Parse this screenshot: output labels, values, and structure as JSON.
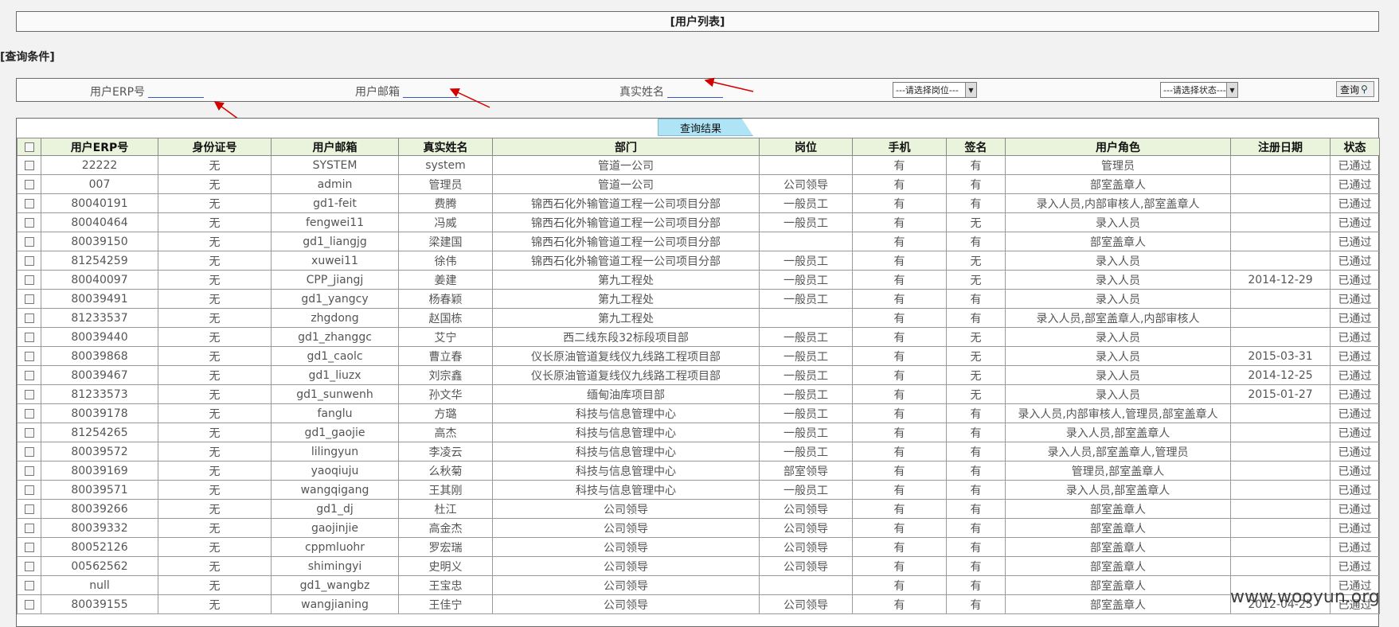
{
  "page": {
    "title": "[用户列表]",
    "query_section_label": "[查询条件]"
  },
  "query": {
    "erp_label": "用户ERP号",
    "email_label": "用户邮箱",
    "realname_label": "真实姓名",
    "position_select": "---请选择岗位---",
    "status_select": "---请选择状态---",
    "search_button": "查询"
  },
  "results": {
    "tab_label": "查询结果",
    "columns": [
      "",
      "用户ERP号",
      "身份证号",
      "用户邮箱",
      "真实姓名",
      "部门",
      "岗位",
      "手机",
      "签名",
      "用户角色",
      "注册日期",
      "状态"
    ],
    "rows": [
      [
        "22222",
        "无",
        "SYSTEM",
        "system",
        "管道一公司",
        "",
        "有",
        "有",
        "管理员",
        "",
        "已通过"
      ],
      [
        "007",
        "无",
        "admin",
        "管理员",
        "管道一公司",
        "公司领导",
        "有",
        "有",
        "部室盖章人",
        "",
        "已通过"
      ],
      [
        "80040191",
        "无",
        "gd1-feit",
        "费腾",
        "锦西石化外输管道工程一公司项目分部",
        "一般员工",
        "有",
        "有",
        "录入人员,内部审核人,部室盖章人",
        "",
        "已通过"
      ],
      [
        "80040464",
        "无",
        "fengwei11",
        "冯威",
        "锦西石化外输管道工程一公司项目分部",
        "一般员工",
        "有",
        "无",
        "录入人员",
        "",
        "已通过"
      ],
      [
        "80039150",
        "无",
        "gd1_liangjg",
        "梁建国",
        "锦西石化外输管道工程一公司项目分部",
        "",
        "有",
        "有",
        "部室盖章人",
        "",
        "已通过"
      ],
      [
        "81254259",
        "无",
        "xuwei11",
        "徐伟",
        "锦西石化外输管道工程一公司项目分部",
        "一般员工",
        "有",
        "无",
        "录入人员",
        "",
        "已通过"
      ],
      [
        "80040097",
        "无",
        "CPP_jiangj",
        "姜建",
        "第九工程处",
        "一般员工",
        "有",
        "无",
        "录入人员",
        "2014-12-29",
        "已通过"
      ],
      [
        "80039491",
        "无",
        "gd1_yangcy",
        "杨春颖",
        "第九工程处",
        "一般员工",
        "有",
        "有",
        "录入人员",
        "",
        "已通过"
      ],
      [
        "81233537",
        "无",
        "zhgdong",
        "赵国栋",
        "第九工程处",
        "",
        "有",
        "有",
        "录入人员,部室盖章人,内部审核人",
        "",
        "已通过"
      ],
      [
        "80039440",
        "无",
        "gd1_zhanggc",
        "艾宁",
        "西二线东段32标段项目部",
        "一般员工",
        "有",
        "无",
        "录入人员",
        "",
        "已通过"
      ],
      [
        "80039868",
        "无",
        "gd1_caolc",
        "曹立春",
        "仪长原油管道复线仪九线路工程项目部",
        "一般员工",
        "有",
        "无",
        "录入人员",
        "2015-03-31",
        "已通过"
      ],
      [
        "80039467",
        "无",
        "gd1_liuzx",
        "刘宗鑫",
        "仪长原油管道复线仪九线路工程项目部",
        "一般员工",
        "有",
        "无",
        "录入人员",
        "2014-12-25",
        "已通过"
      ],
      [
        "81233573",
        "无",
        "gd1_sunwenh",
        "孙文华",
        "缅甸油库项目部",
        "一般员工",
        "有",
        "无",
        "录入人员",
        "2015-01-27",
        "已通过"
      ],
      [
        "80039178",
        "无",
        "fanglu",
        "方璐",
        "科技与信息管理中心",
        "一般员工",
        "有",
        "有",
        "录入人员,内部审核人,管理员,部室盖章人",
        "",
        "已通过"
      ],
      [
        "81254265",
        "无",
        "gd1_gaojie",
        "高杰",
        "科技与信息管理中心",
        "一般员工",
        "有",
        "有",
        "录入人员,部室盖章人",
        "",
        "已通过"
      ],
      [
        "80039572",
        "无",
        "lilingyun",
        "李凌云",
        "科技与信息管理中心",
        "一般员工",
        "有",
        "有",
        "录入人员,部室盖章人,管理员",
        "",
        "已通过"
      ],
      [
        "80039169",
        "无",
        "yaoqiuju",
        "么秋菊",
        "科技与信息管理中心",
        "部室领导",
        "有",
        "有",
        "管理员,部室盖章人",
        "",
        "已通过"
      ],
      [
        "80039571",
        "无",
        "wangqigang",
        "王其刚",
        "科技与信息管理中心",
        "一般员工",
        "有",
        "有",
        "录入人员,部室盖章人",
        "",
        "已通过"
      ],
      [
        "80039266",
        "无",
        "gd1_dj",
        "杜江",
        "公司领导",
        "公司领导",
        "有",
        "有",
        "部室盖章人",
        "",
        "已通过"
      ],
      [
        "80039332",
        "无",
        "gaojinjie",
        "高金杰",
        "公司领导",
        "公司领导",
        "有",
        "有",
        "部室盖章人",
        "",
        "已通过"
      ],
      [
        "80052126",
        "无",
        "cppmluohr",
        "罗宏瑞",
        "公司领导",
        "公司领导",
        "有",
        "有",
        "部室盖章人",
        "",
        "已通过"
      ],
      [
        "00562562",
        "无",
        "shimingyi",
        "史明义",
        "公司领导",
        "公司领导",
        "有",
        "有",
        "部室盖章人",
        "",
        "已通过"
      ],
      [
        "null",
        "无",
        "gd1_wangbz",
        "王宝忠",
        "公司领导",
        "",
        "有",
        "有",
        "部室盖章人",
        "",
        "已通过"
      ],
      [
        "80039155",
        "无",
        "wangjianing",
        "王佳宁",
        "公司领导",
        "公司领导",
        "有",
        "有",
        "部室盖章人",
        "2012-04-25",
        "已通过"
      ]
    ]
  },
  "watermark": "www.wooyun.org"
}
